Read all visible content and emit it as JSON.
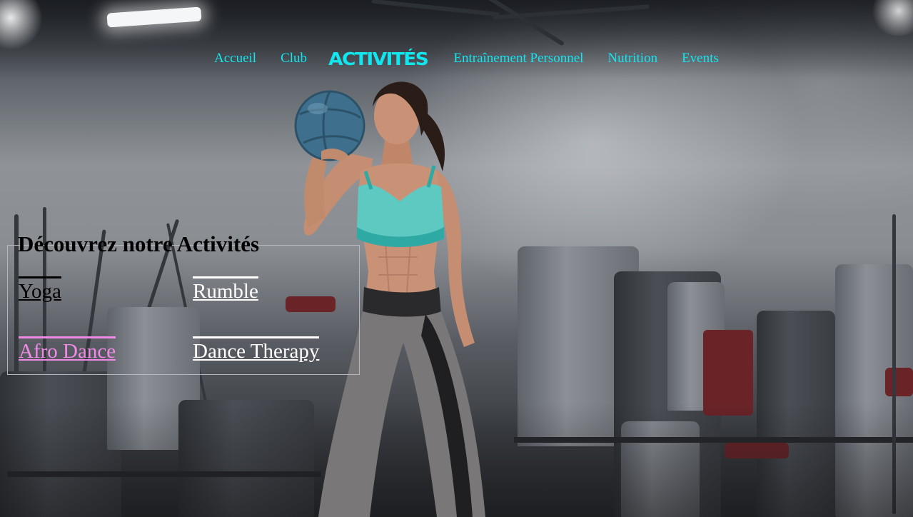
{
  "nav": {
    "items": [
      {
        "label": "Accueil",
        "active": false
      },
      {
        "label": "Club",
        "active": false
      },
      {
        "label": "ACTIVITÉS",
        "active": true
      },
      {
        "label": "Entraînement Personnel",
        "active": false
      },
      {
        "label": "Nutrition",
        "active": false
      },
      {
        "label": "Events",
        "active": false
      }
    ]
  },
  "activities": {
    "title": "Découvrez notre Activités",
    "items": [
      {
        "label": "Yoga",
        "color": "#000000"
      },
      {
        "label": "Rumble",
        "color": "#ffffff"
      },
      {
        "label": "Afro Dance",
        "color": "#f08ae6"
      },
      {
        "label": "Dance Therapy",
        "color": "#ffffff"
      }
    ]
  },
  "colors": {
    "nav_link": "#11e6ee",
    "title": "#000000",
    "fieldset_border": "#b4b8bc"
  },
  "hero": {
    "icon": "athlete-with-medicine-ball-image"
  }
}
